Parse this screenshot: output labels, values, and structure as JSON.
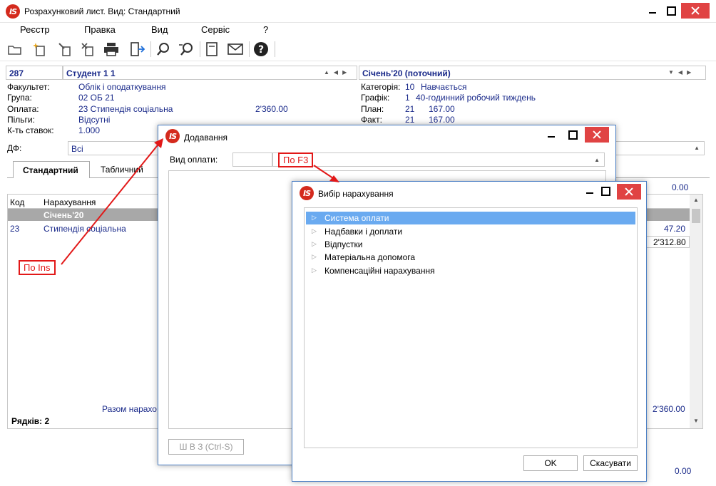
{
  "window": {
    "title": "Розрахунковий лист. Вид: Стандартний",
    "logo": "IS"
  },
  "menu": [
    "Реєстр",
    "Правка",
    "Вид",
    "Сервіс",
    "?"
  ],
  "toolbar_icons": [
    "open-icon",
    "new-icon",
    "edit-icon",
    "copy-icon",
    "print-icon",
    "exit-icon",
    "search-icon",
    "search-next-icon",
    "document-icon",
    "mail-icon",
    "help-icon"
  ],
  "header": {
    "id": "287",
    "name": "Студент 1 1",
    "period": "Січень'20 (поточний)",
    "left": [
      {
        "label": "Факультет:",
        "value": "Облік і оподаткування"
      },
      {
        "label": "Група:",
        "value": "02 ОБ 21"
      },
      {
        "label": "Оплата:",
        "value": "23 Стипендія соціальна",
        "amount": "2'360.00"
      },
      {
        "label": "Пільги:",
        "value": "Відсутні"
      },
      {
        "label": "К-ть ставок:",
        "value": "1.000"
      }
    ],
    "right": [
      {
        "label": "Категорія:",
        "code": "10",
        "value": "Навчається"
      },
      {
        "label": "Графік:",
        "code": "1",
        "value": "40-годинний робочий тиждень"
      },
      {
        "label": "План:",
        "code": "21",
        "value": "167.00"
      },
      {
        "label": "Факт:",
        "code": "21",
        "value": "167.00"
      }
    ],
    "df_label": "ДФ:",
    "df_value": "Всі"
  },
  "tabs": [
    "Стандартний",
    "Табличний"
  ],
  "grid": {
    "columns": [
      "Код",
      "Нарахування"
    ],
    "month": "Січень'20",
    "rows": [
      {
        "code": "23",
        "name": "Стипендія соціальна",
        "right1": "47.20",
        "right2": "2'312.80"
      }
    ],
    "top_value": "0.00",
    "total_label": "Разом нарахо",
    "total_value": "2'360.00",
    "rows_count": "Рядків: 2",
    "bottom_value": "0.00"
  },
  "dialog_add": {
    "title": "Додавання",
    "field_label": "Вид оплати:",
    "save_button": "Ш В З (Ctrl-S)"
  },
  "dialog_select": {
    "title": "Вибір нарахування",
    "items": [
      "Система оплати",
      "Надбавки і доплати",
      "Відпустки",
      "Матеріальна допомога",
      "Компенсаційні нарахування"
    ],
    "ok": "OK",
    "cancel": "Скасувати"
  },
  "annotations": {
    "ins": "По Ins",
    "f3": "По F3",
    "color": "#e21818"
  }
}
